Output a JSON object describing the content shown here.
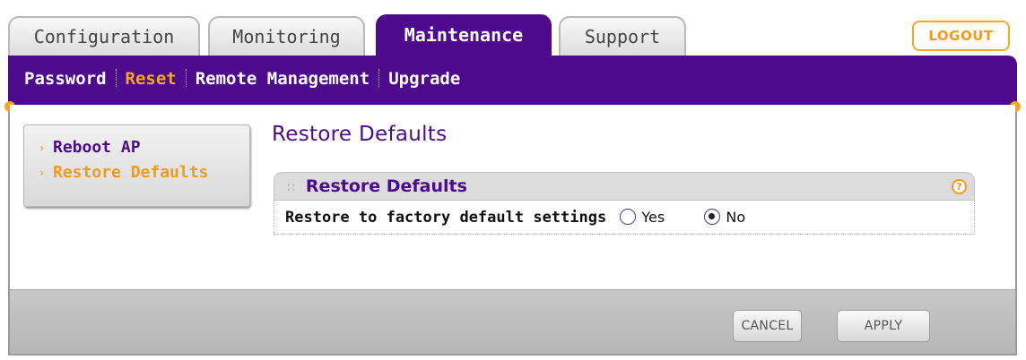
{
  "tabs": [
    {
      "label": "Configuration",
      "active": false
    },
    {
      "label": "Monitoring",
      "active": false
    },
    {
      "label": "Maintenance",
      "active": true
    },
    {
      "label": "Support",
      "active": false
    }
  ],
  "logout_label": "LOGOUT",
  "subnav": [
    {
      "label": "Password",
      "active": false
    },
    {
      "label": "Reset",
      "active": true
    },
    {
      "label": "Remote Management",
      "active": false
    },
    {
      "label": "Upgrade",
      "active": false
    }
  ],
  "sidemenu": [
    {
      "label": "Reboot AP",
      "active": false
    },
    {
      "label": "Restore Defaults",
      "active": true
    }
  ],
  "page_title": "Restore Defaults",
  "panel": {
    "title": "Restore Defaults",
    "help_icon": "?",
    "row_label": "Restore to factory default settings",
    "options": [
      {
        "label": "Yes",
        "checked": false
      },
      {
        "label": "No",
        "checked": true
      }
    ]
  },
  "buttons": {
    "cancel": "CANCEL",
    "apply": "APPLY"
  },
  "colors": {
    "brand_purple": "#4d0a8c",
    "accent_orange": "#f5a623"
  }
}
